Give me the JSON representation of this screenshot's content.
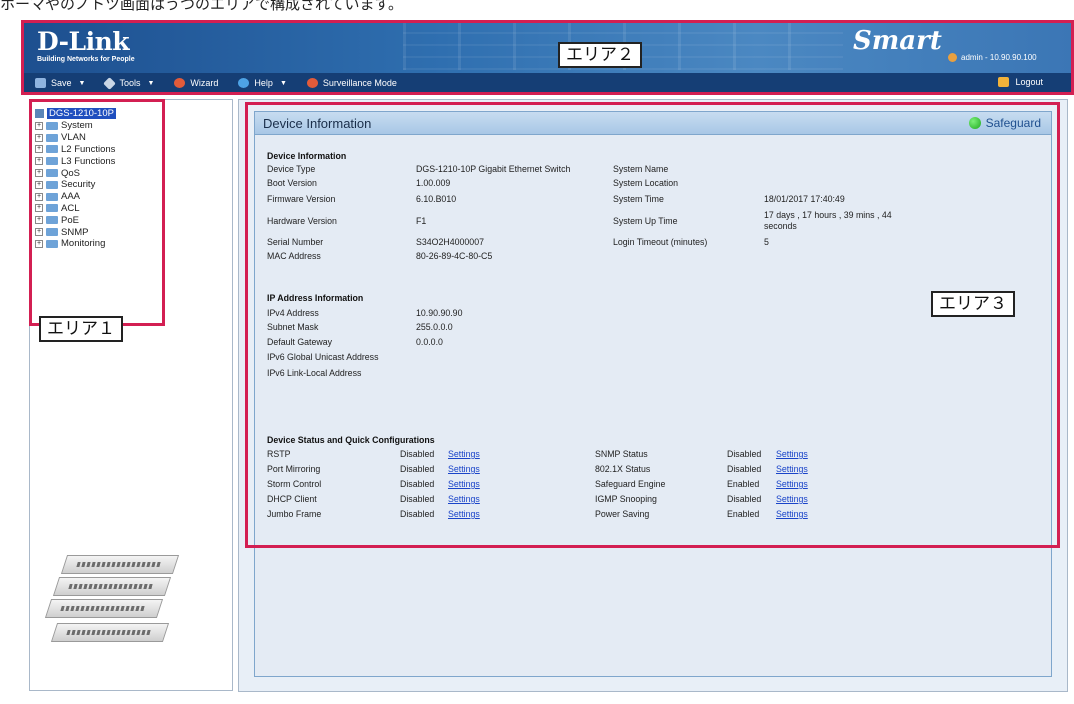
{
  "caption": "ホーマやのノトツ画面はうつのエリアで構成されています。",
  "header": {
    "logo_main": "D-Link",
    "logo_sub": "Building Networks for People",
    "smart_logo": "Smart",
    "admin": "admin - 10.90.90.100",
    "menu": [
      {
        "label": "Save",
        "icon": "save-icon",
        "dropdown": true
      },
      {
        "label": "Tools",
        "icon": "tools-icon",
        "dropdown": true
      },
      {
        "label": "Wizard",
        "icon": "wizard-icon",
        "dropdown": false
      },
      {
        "label": "Help",
        "icon": "help-icon",
        "dropdown": true
      },
      {
        "label": "Surveillance Mode",
        "icon": "surveillance-icon",
        "dropdown": false
      }
    ],
    "logout": "Logout"
  },
  "tree": {
    "root": "DGS-1210-10P",
    "items": [
      "System",
      "VLAN",
      "L2 Functions",
      "L3 Functions",
      "QoS",
      "Security",
      "AAA",
      "ACL",
      "PoE",
      "SNMP",
      "Monitoring"
    ]
  },
  "panel": {
    "title": "Device Information",
    "safeguard": "Safeguard"
  },
  "device_info": {
    "heading": "Device Information",
    "left": [
      {
        "label": "Device Type",
        "value": "DGS-1210-10P Gigabit Ethernet Switch"
      },
      {
        "label": "Boot Version",
        "value": "1.00.009"
      },
      {
        "label": "Firmware Version",
        "value": "6.10.B010"
      },
      {
        "label": "Hardware Version",
        "value": "F1"
      },
      {
        "label": "Serial Number",
        "value": "S34O2H4000007"
      },
      {
        "label": "MAC Address",
        "value": "80-26-89-4C-80-C5"
      }
    ],
    "right": [
      {
        "label": "System Name",
        "value": ""
      },
      {
        "label": "System Location",
        "value": ""
      },
      {
        "label": "System Time",
        "value": "18/01/2017 17:40:49"
      },
      {
        "label": "System Up Time",
        "value": "17 days , 17 hours , 39 mins , 44",
        "value2": "seconds"
      },
      {
        "label": "Login Timeout (minutes)",
        "value": "5"
      }
    ]
  },
  "ip_info": {
    "heading": "IP Address Information",
    "rows": [
      {
        "label": "IPv4 Address",
        "value": "10.90.90.90"
      },
      {
        "label": "Subnet Mask",
        "value": "255.0.0.0"
      },
      {
        "label": "Default Gateway",
        "value": "0.0.0.0"
      },
      {
        "label": "IPv6 Global Unicast Address",
        "value": ""
      },
      {
        "label": "IPv6 Link-Local Address",
        "value": ""
      }
    ]
  },
  "status": {
    "heading": "Device Status and Quick Configurations",
    "link_text": "Settings",
    "left": [
      {
        "label": "RSTP",
        "state": "Disabled"
      },
      {
        "label": "Port Mirroring",
        "state": "Disabled"
      },
      {
        "label": "Storm Control",
        "state": "Disabled"
      },
      {
        "label": "DHCP Client",
        "state": "Disabled"
      },
      {
        "label": "Jumbo Frame",
        "state": "Disabled"
      }
    ],
    "right": [
      {
        "label": "SNMP Status",
        "state": "Disabled"
      },
      {
        "label": "802.1X Status",
        "state": "Disabled"
      },
      {
        "label": "Safeguard Engine",
        "state": "Enabled"
      },
      {
        "label": "IGMP Snooping",
        "state": "Disabled"
      },
      {
        "label": "Power Saving",
        "state": "Enabled"
      }
    ]
  },
  "annotations": {
    "area1": "エリア１",
    "area2": "エリア２",
    "area3": "エリア３"
  },
  "colors": {
    "annotation_border": "#d31f52",
    "header_blue": "#2f6fb0",
    "link_blue": "#1a44c9",
    "safeguard_green": "#1ea81e"
  }
}
